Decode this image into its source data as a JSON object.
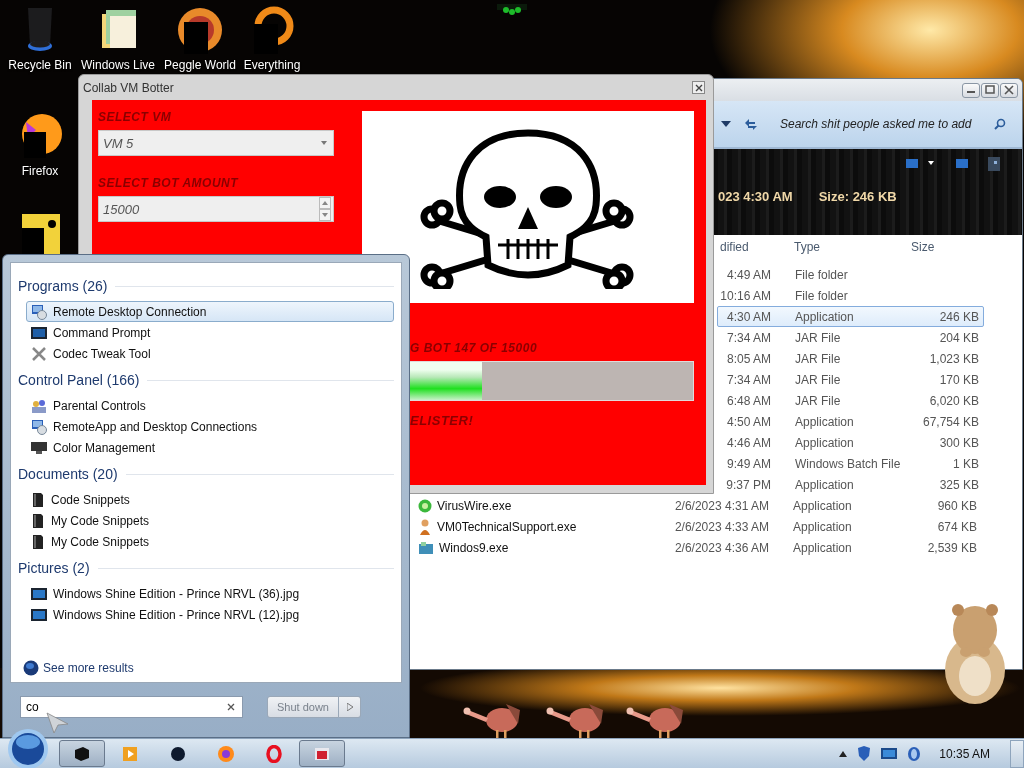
{
  "desktop": {
    "icons": [
      {
        "label": "Recycle Bin",
        "kind": "bin"
      },
      {
        "label": "Windows Live",
        "kind": "folders"
      },
      {
        "label": "Peggle World",
        "kind": "ball"
      },
      {
        "label": "Everything",
        "kind": "ring"
      },
      {
        "label": "Firefox",
        "kind": "firefox"
      },
      {
        "kind": "app"
      }
    ]
  },
  "explorer": {
    "search": {
      "placeholder": "Search shit people asked me to add"
    },
    "details": {
      "modified": "023 4:30 AM",
      "size": "Size: 246 KB"
    },
    "columns": [
      "dified",
      "Type",
      "Size"
    ],
    "rows": [
      {
        "modified": "4:49 AM",
        "type": "File folder",
        "selected": false
      },
      {
        "modified": "10:16 AM",
        "type": "File folder",
        "selected": false
      },
      {
        "modified": "4:30 AM",
        "type": "Application",
        "size": "246 KB",
        "selected": true
      },
      {
        "modified": "7:34 AM",
        "type": "JAR File",
        "size": "204 KB",
        "selected": false
      },
      {
        "modified": "8:05 AM",
        "type": "JAR File",
        "size": "1,023 KB",
        "selected": false
      },
      {
        "modified": "7:34 AM",
        "type": "JAR File",
        "size": "170 KB",
        "selected": false
      },
      {
        "modified": "6:48 AM",
        "type": "JAR File",
        "size": "6,020 KB",
        "selected": false
      },
      {
        "modified": "4:50 AM",
        "type": "Application",
        "size": "67,754 KB",
        "selected": false
      },
      {
        "modified": "4:46 AM",
        "type": "Application",
        "size": "300 KB",
        "selected": false
      },
      {
        "modified": "9:49 AM",
        "type": "Windows Batch File",
        "size": "1 KB",
        "selected": false
      },
      {
        "modified": "9:37 PM",
        "type": "Application",
        "size": "325 KB",
        "selected": false
      },
      {
        "name": "VirusWire.exe",
        "kind": "virus",
        "modified": "2/6/2023 4:31 AM",
        "type": "Application",
        "size": "960 KB",
        "selected": false
      },
      {
        "name": "VM0TechnicalSupport.exe",
        "kind": "person",
        "modified": "2/6/2023 4:33 AM",
        "type": "Application",
        "size": "674 KB",
        "selected": false
      },
      {
        "name": "Windos9.exe",
        "kind": "window",
        "modified": "2/6/2023 4:36 AM",
        "type": "Application",
        "size": "2,539 KB",
        "selected": false
      }
    ]
  },
  "bot_window": {
    "title": "Collab VM Botter",
    "vm_label": "SELECT VM",
    "vm_value": "VM 5",
    "amount_label": "SELECT BOT AMOUNT",
    "amount_value": "15000",
    "status": "G BOT 147 OF 15000",
    "progress": {
      "level": 0.36
    },
    "footer": "ELISTER!"
  },
  "start_menu": {
    "groups": [
      {
        "title": "Programs (26)",
        "items": [
          {
            "label": "Remote Desktop Connection",
            "kind": "remote",
            "selected": true
          },
          {
            "label": "Command Prompt",
            "kind": "cmd",
            "selected": false
          },
          {
            "label": "Codec Tweak Tool",
            "kind": "tools",
            "selected": false
          }
        ]
      },
      {
        "title": "Control Panel (166)",
        "items": [
          {
            "label": "Parental Controls",
            "kind": "people",
            "selected": false
          },
          {
            "label": "RemoteApp and Desktop Connections",
            "kind": "remote",
            "selected": false
          },
          {
            "label": "Color Management",
            "kind": "monitor",
            "selected": false
          }
        ]
      },
      {
        "title": "Documents (20)",
        "items": [
          {
            "label": "Code Snippets",
            "kind": "doc",
            "selected": false
          },
          {
            "label": "My Code Snippets",
            "kind": "doc",
            "selected": false
          },
          {
            "label": "My Code Snippets",
            "kind": "doc",
            "selected": false
          }
        ]
      },
      {
        "title": "Pictures (2)",
        "items": [
          {
            "label": "Windows Shine Edition - Prince NRVL (36).jpg",
            "kind": "image",
            "selected": false
          },
          {
            "label": "Windows Shine Edition - Prince NRVL (12).jpg",
            "kind": "image",
            "selected": false
          }
        ]
      }
    ],
    "see_more": "See more results",
    "search": {
      "value": "co"
    },
    "shutdown": {
      "label": "Shut down",
      "disabled": true
    }
  },
  "taskbar": {
    "buttons": [
      {
        "kind": "box",
        "active": true
      },
      {
        "kind": "media",
        "active": false
      },
      {
        "kind": "circle",
        "active": false
      },
      {
        "kind": "firefox",
        "active": false
      },
      {
        "kind": "opera",
        "active": false
      },
      {
        "kind": "app",
        "active": true
      }
    ],
    "clock": "10:35 AM"
  }
}
